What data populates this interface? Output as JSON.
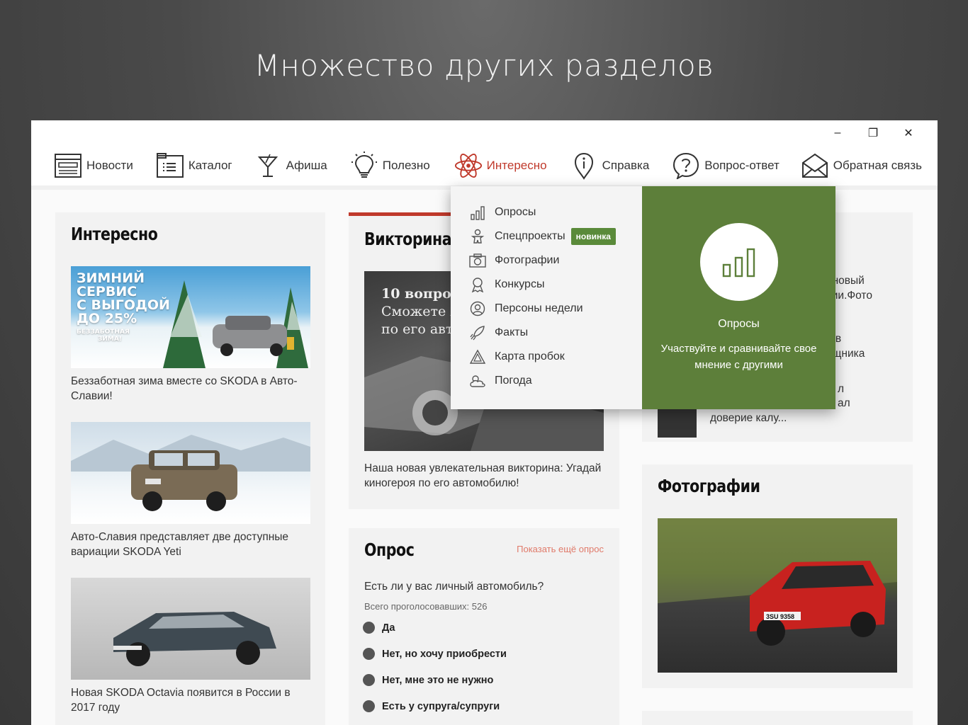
{
  "heading": "Множество других разделов",
  "window_controls": {
    "minimize": "–",
    "restore": "❐",
    "close": "✕"
  },
  "nav": [
    {
      "label": "Новости",
      "icon": "newspaper-icon"
    },
    {
      "label": "Каталог",
      "icon": "catalog-icon"
    },
    {
      "label": "Афиша",
      "icon": "cocktail-icon"
    },
    {
      "label": "Полезно",
      "icon": "lightbulb-icon"
    },
    {
      "label": "Интересно",
      "icon": "atom-icon",
      "active": true
    },
    {
      "label": "Справка",
      "icon": "info-icon"
    },
    {
      "label": "Вопрос-ответ",
      "icon": "question-icon"
    },
    {
      "label": "Обратная связь",
      "icon": "envelope-icon"
    }
  ],
  "interesting": {
    "title": "Интересно",
    "banner": {
      "line1": "ЗИМНИЙ",
      "line2": "СЕРВИС",
      "line3": "С ВЫГОДОЙ",
      "line4": "ДО 25%",
      "line5": "БЕЗЗАБОТНАЯ",
      "line6": "ЗИМА!"
    },
    "items": [
      {
        "caption": "Беззаботная зима вместе со SKODA в Авто-Славии!"
      },
      {
        "caption": "Авто-Славия представляет две доступные вариации SKODA Yeti"
      },
      {
        "caption": "Новая SKODA Octavia появится в России в 2017 году"
      }
    ]
  },
  "quiz": {
    "title": "Викторина",
    "image_text_1": "10 вопрос",
    "image_text_2": "Сможете л",
    "image_text_3": "по его авт",
    "caption": "Наша новая увлекательная викторина: Угадай киногероя по его автомобилю!"
  },
  "poll": {
    "title": "Опрос",
    "more_link": "Показать ещё опрос",
    "question": "Есть ли у вас личный автомобиль?",
    "votes": "Всего проголосовавших: 526",
    "options": [
      "Да",
      "Нет, но хочу приобрести",
      "Нет, мне это не нужно",
      "Есть у супруга/супруги"
    ]
  },
  "right_partial": {
    "line1": ": новый",
    "line2": "хии.Фото",
    "line3": "q в",
    "line4": "ищника",
    "line5": "л",
    "line6": "ал",
    "line7": "доверие калу..."
  },
  "photos": {
    "title": "Фотографии",
    "plate": "3SU 9358"
  },
  "dropdown": {
    "items": [
      {
        "label": "Опросы",
        "icon": "bar-chart-icon"
      },
      {
        "label": "Спецпроекты",
        "icon": "gingerbread-icon",
        "badge": "новинка"
      },
      {
        "label": "Фотографии",
        "icon": "camera-icon"
      },
      {
        "label": "Конкурсы",
        "icon": "award-icon"
      },
      {
        "label": "Персоны недели",
        "icon": "person-icon"
      },
      {
        "label": "Факты",
        "icon": "rocket-icon"
      },
      {
        "label": "Карта пробок",
        "icon": "warning-icon"
      },
      {
        "label": "Погода",
        "icon": "weather-icon"
      }
    ],
    "panel": {
      "title": "Опросы",
      "description": "Участвуйте и сравнивайте свое мнение с другими"
    }
  },
  "colors": {
    "accent_red": "#c0392b",
    "panel_green": "#5d7f3a",
    "badge_green": "#5a8a3a"
  }
}
